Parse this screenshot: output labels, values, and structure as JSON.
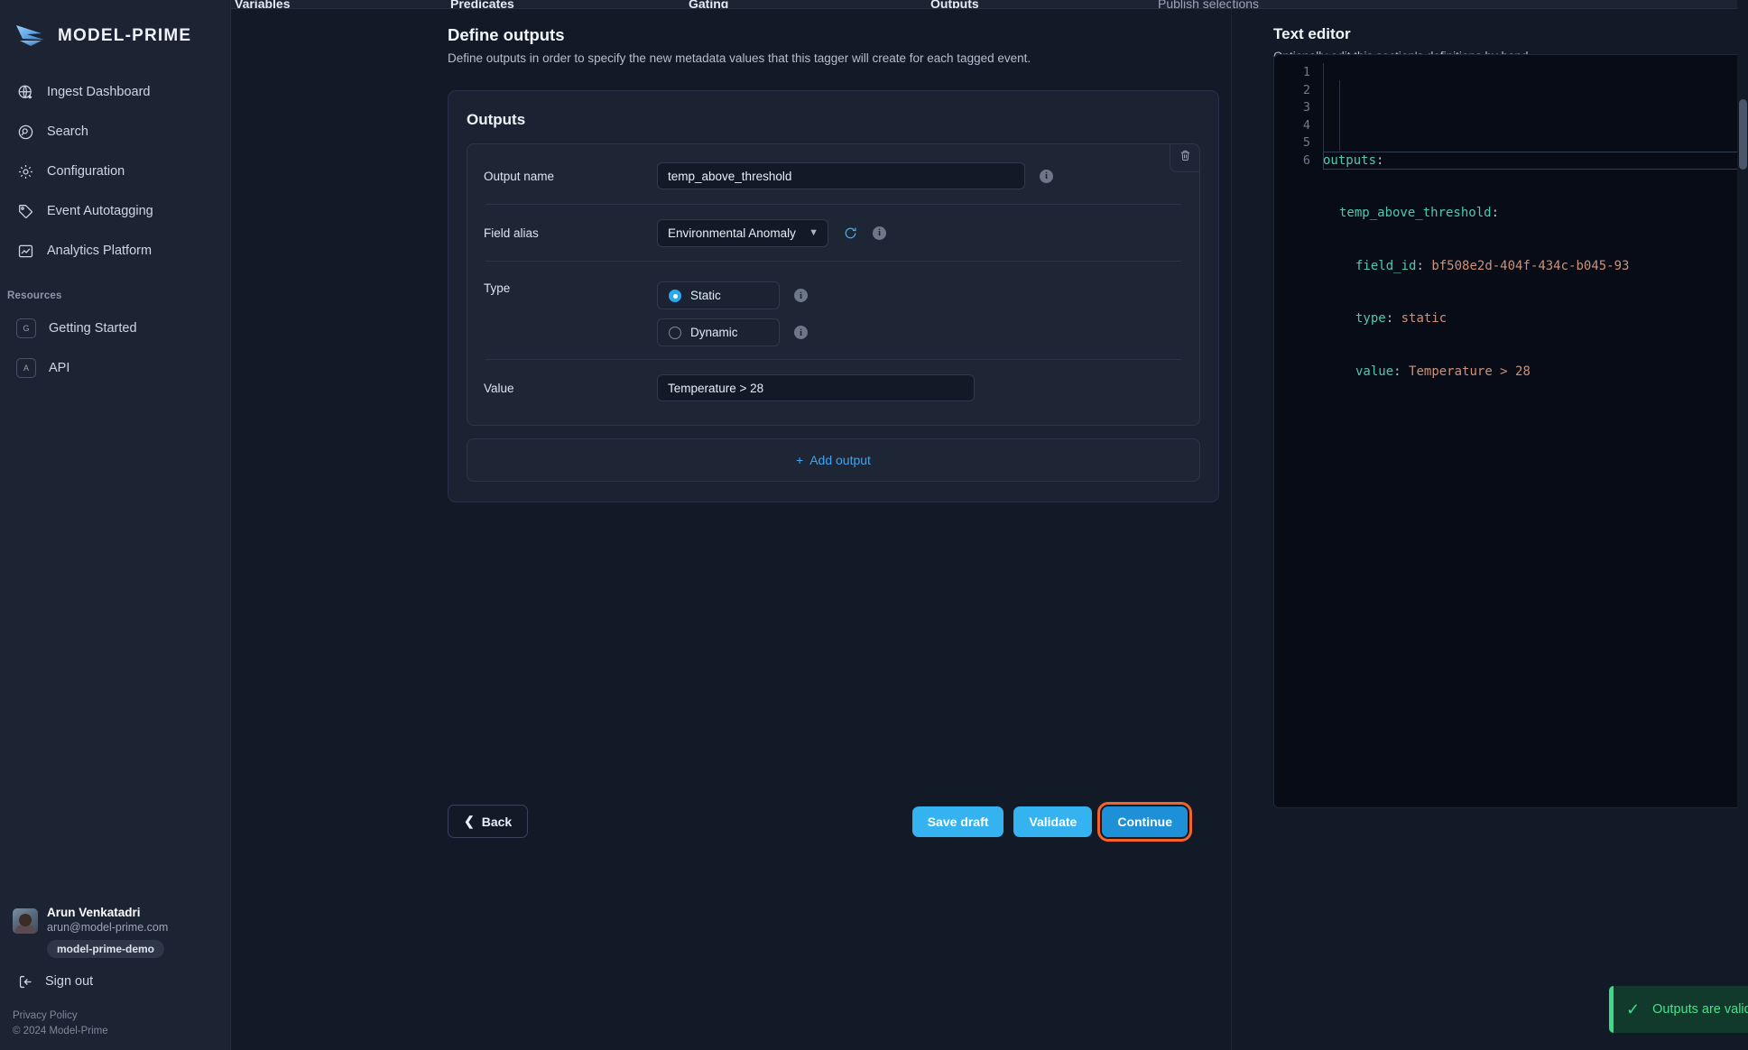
{
  "brand": {
    "name": "MODEL-PRIME",
    "logo_icon": "model-prime-wing-logo"
  },
  "sidebar": {
    "nav": [
      {
        "label": "Ingest Dashboard",
        "icon": "globe-download-icon"
      },
      {
        "label": "Search",
        "icon": "search-circle-icon"
      },
      {
        "label": "Configuration",
        "icon": "gear-icon"
      },
      {
        "label": "Event Autotagging",
        "icon": "tag-icon"
      },
      {
        "label": "Analytics Platform",
        "icon": "image-chart-icon"
      }
    ],
    "section_label": "Resources",
    "resources": [
      {
        "label": "Getting Started",
        "badge": "G"
      },
      {
        "label": "API",
        "badge": "A"
      }
    ],
    "user": {
      "name": "Arun Venkatadri",
      "email": "arun@model-prime.com",
      "org": "model-prime-demo",
      "avatar_icon": "user-avatar"
    },
    "signout": {
      "label": "Sign out",
      "icon": "sign-out-icon"
    },
    "footer": {
      "privacy": "Privacy Policy",
      "copyright": "© 2024 Model-Prime"
    }
  },
  "steps": [
    {
      "label": "Variables",
      "active": true
    },
    {
      "label": "Predicates",
      "active": true
    },
    {
      "label": "Gating",
      "active": true
    },
    {
      "label": "Outputs",
      "active": true
    },
    {
      "label": "Publish selections",
      "active": false
    }
  ],
  "main": {
    "title": "Define outputs",
    "subtitle": "Define outputs in order to specify the new metadata values that this tagger will create for each tagged event.",
    "card_title": "Outputs",
    "delete_icon": "trash-icon",
    "fields": {
      "output_name": {
        "label": "Output name",
        "value": "temp_above_threshold",
        "placeholder": "",
        "info_icon": "info-icon"
      },
      "field_alias": {
        "label": "Field alias",
        "value": "Environmental Anomaly",
        "chevron": "chevron-down-icon",
        "refresh_icon": "refresh-icon",
        "info_icon": "info-icon"
      },
      "type": {
        "label": "Type",
        "options": [
          {
            "label": "Static",
            "selected": true
          },
          {
            "label": "Dynamic",
            "selected": false
          }
        ]
      },
      "value": {
        "label": "Value",
        "value": "Temperature > 28",
        "placeholder": ""
      }
    },
    "add_output": {
      "label": "Add output",
      "plus": "+"
    },
    "actions": {
      "back": {
        "label": "Back",
        "icon": "chevron-left-icon"
      },
      "save_draft": "Save draft",
      "validate": "Validate",
      "continue": "Continue"
    }
  },
  "editor": {
    "title": "Text editor",
    "subtitle": "Optionally edit this section's definitions by hand.",
    "line_numbers": [
      "1",
      "2",
      "3",
      "4",
      "5",
      "6"
    ],
    "lines": [
      {
        "key": "outputs",
        "colon": ":",
        "value": "",
        "indent": 0
      },
      {
        "key": "temp_above_threshold",
        "colon": ":",
        "value": "",
        "indent": 1
      },
      {
        "key": "field_id",
        "colon": ":",
        "value": "bf508e2d-404f-434c-b045-93",
        "indent": 2
      },
      {
        "key": "type",
        "colon": ":",
        "value": "static",
        "indent": 2
      },
      {
        "key": "value",
        "colon": ":",
        "value": "Temperature > 28",
        "indent": 2
      },
      {
        "key": "",
        "colon": "",
        "value": "",
        "indent": 0
      }
    ]
  },
  "toast": {
    "message": "Outputs are valid",
    "check_icon": "check-icon",
    "close_icon": "close-icon",
    "accent_color": "#3ddc84"
  },
  "colors": {
    "accent_blue": "#35b3f0",
    "focus_orange": "#f4642a",
    "sidebar_bg": "#1c2433",
    "main_bg": "#121a28",
    "card_bg": "#1b2333",
    "yaml_key": "#4ec9b0",
    "yaml_value": "#ce9178"
  }
}
